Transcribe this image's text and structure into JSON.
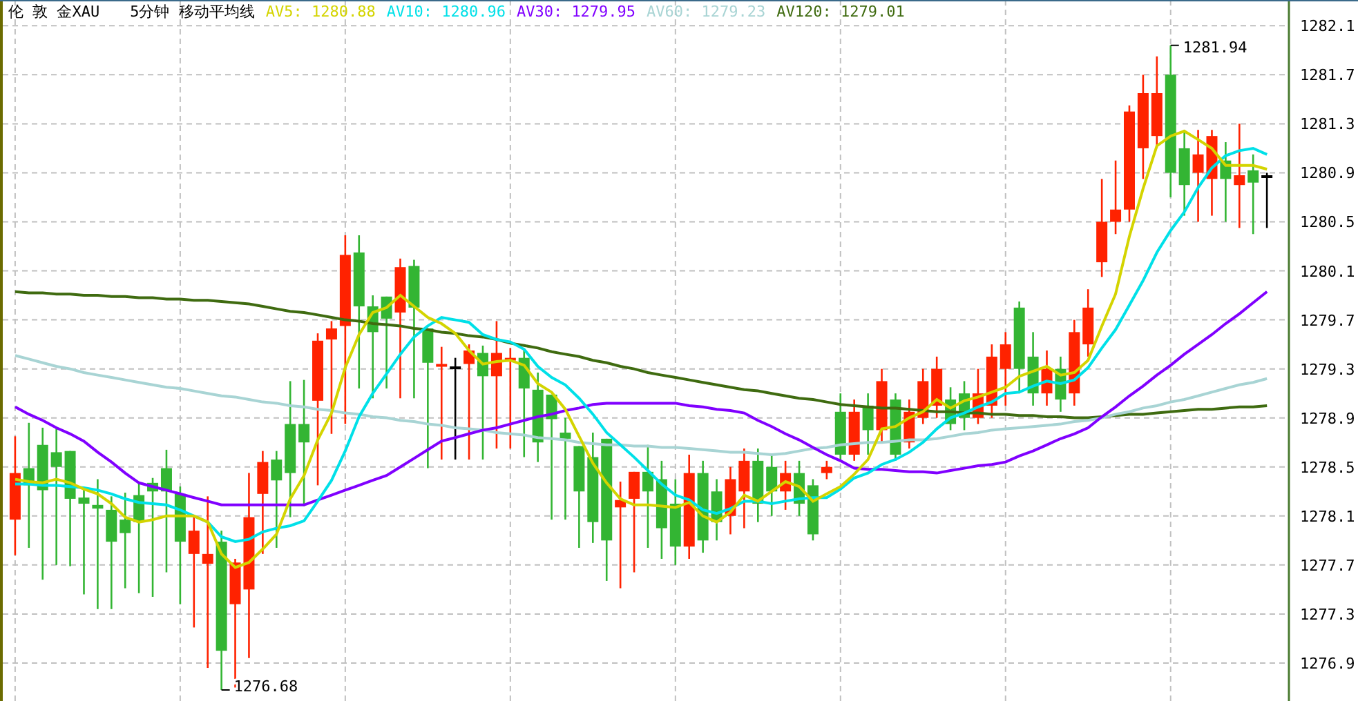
{
  "header": {
    "instrument": "伦 敦 金XAU",
    "period": "5分钟 移动平均线",
    "legend": [
      {
        "value": "1280.88"
      },
      {
        "value": "1280.96"
      },
      {
        "value": "1279.95"
      },
      {
        "value": "1279.23"
      },
      {
        "value": "1279.01"
      }
    ]
  },
  "chart": {
    "chart_data": {
      "type": "candlestick",
      "grid": true,
      "ohlc": [
        [
          1278.07,
          1278.75,
          1277.78,
          1278.45
        ],
        [
          1278.49,
          1278.86,
          1277.84,
          1278.35
        ],
        [
          1278.68,
          1278.82,
          1277.58,
          1278.31
        ],
        [
          1278.62,
          1278.82,
          1277.7,
          1278.5
        ],
        [
          1278.63,
          1278.63,
          1277.69,
          1278.24
        ],
        [
          1278.25,
          1278.32,
          1277.46,
          1278.2
        ],
        [
          1278.19,
          1278.4,
          1277.34,
          1278.16
        ],
        [
          1278.15,
          1278.26,
          1277.34,
          1277.89
        ],
        [
          1278.07,
          1278.29,
          1277.51,
          1277.96
        ],
        [
          1278.27,
          1278.37,
          1277.47,
          1278.05
        ],
        [
          1278.37,
          1278.41,
          1277.44,
          1278.3
        ],
        [
          1278.49,
          1278.64,
          1277.64,
          1278.3
        ],
        [
          1278.28,
          1278.34,
          1277.38,
          1277.89
        ],
        [
          1277.79,
          1278.11,
          1277.19,
          1277.98
        ],
        [
          1277.71,
          1278.26,
          1276.86,
          1277.79
        ],
        [
          1277.89,
          1277.98,
          1276.68,
          1277.0
        ],
        [
          1277.38,
          1277.75,
          1276.7,
          1277.72
        ],
        [
          1277.5,
          1278.45,
          1276.94,
          1278.09
        ],
        [
          1278.28,
          1278.63,
          1277.79,
          1278.54
        ],
        [
          1278.56,
          1278.63,
          1277.84,
          1278.39
        ],
        [
          1278.85,
          1279.2,
          1278.09,
          1278.45
        ],
        [
          1278.85,
          1279.21,
          1278.18,
          1278.7
        ],
        [
          1279.04,
          1279.59,
          1278.35,
          1279.53
        ],
        [
          1279.54,
          1279.69,
          1278.77,
          1279.63
        ],
        [
          1279.65,
          1280.39,
          1278.85,
          1280.23
        ],
        [
          1280.25,
          1280.39,
          1279.14,
          1279.81
        ],
        [
          1279.81,
          1279.9,
          1279.06,
          1279.6
        ],
        [
          1279.89,
          1279.89,
          1279.14,
          1279.71
        ],
        [
          1279.76,
          1280.2,
          1279.06,
          1280.13
        ],
        [
          1280.14,
          1280.19,
          1279.06,
          1279.8
        ],
        [
          1279.63,
          1279.63,
          1278.49,
          1279.35
        ],
        [
          1279.32,
          1279.48,
          1278.56,
          1279.34
        ],
        [
          1279.32,
          1279.39,
          1278.56,
          1279.32
        ],
        [
          1279.34,
          1279.5,
          1278.56,
          1279.45
        ],
        [
          1279.43,
          1279.49,
          1278.56,
          1279.24
        ],
        [
          1279.24,
          1279.69,
          1278.65,
          1279.43
        ],
        [
          1279.37,
          1279.47,
          1278.65,
          1279.39
        ],
        [
          1279.39,
          1279.46,
          1278.58,
          1279.14
        ],
        [
          1279.13,
          1279.27,
          1278.54,
          1278.7
        ],
        [
          1279.09,
          1279.09,
          1278.07,
          1278.89
        ],
        [
          1278.78,
          1278.9,
          1278.07,
          1278.73
        ],
        [
          1278.67,
          1278.67,
          1277.84,
          1278.3
        ],
        [
          1278.58,
          1278.78,
          1277.88,
          1278.05
        ],
        [
          1278.73,
          1278.73,
          1277.57,
          1277.9
        ],
        [
          1278.17,
          1278.38,
          1277.51,
          1278.23
        ],
        [
          1278.24,
          1278.46,
          1277.64,
          1278.46
        ],
        [
          1278.46,
          1278.68,
          1277.84,
          1278.3
        ],
        [
          1278.4,
          1278.55,
          1277.75,
          1278.0
        ],
        [
          1278.2,
          1278.4,
          1277.7,
          1277.85
        ],
        [
          1277.85,
          1278.6,
          1277.75,
          1278.45
        ],
        [
          1278.45,
          1278.55,
          1277.8,
          1277.9
        ],
        [
          1278.3,
          1278.4,
          1277.9,
          1278.05
        ],
        [
          1278.1,
          1278.5,
          1277.95,
          1278.4
        ],
        [
          1278.3,
          1278.65,
          1278.0,
          1278.55
        ],
        [
          1278.55,
          1278.65,
          1278.05,
          1278.2
        ],
        [
          1278.5,
          1278.6,
          1278.1,
          1278.3
        ],
        [
          1278.3,
          1278.55,
          1278.15,
          1278.45
        ],
        [
          1278.45,
          1278.55,
          1278.1,
          1278.2
        ],
        [
          1278.35,
          1278.4,
          1277.9,
          1277.95
        ],
        [
          1278.45,
          1278.55,
          1278.4,
          1278.5
        ],
        [
          1278.95,
          1279.1,
          1278.55,
          1278.6
        ],
        [
          1278.6,
          1279.05,
          1278.55,
          1278.95
        ],
        [
          1279.0,
          1279.1,
          1278.6,
          1278.8
        ],
        [
          1278.8,
          1279.3,
          1278.7,
          1279.2
        ],
        [
          1279.05,
          1279.1,
          1278.55,
          1278.6
        ],
        [
          1278.7,
          1279.05,
          1278.65,
          1278.95
        ],
        [
          1278.9,
          1279.3,
          1278.85,
          1279.2
        ],
        [
          1279.0,
          1279.4,
          1278.9,
          1279.3
        ],
        [
          1279.05,
          1279.15,
          1278.8,
          1278.85
        ],
        [
          1279.1,
          1279.2,
          1278.8,
          1278.9
        ],
        [
          1278.9,
          1279.3,
          1278.85,
          1279.1
        ],
        [
          1279.0,
          1279.5,
          1278.9,
          1279.4
        ],
        [
          1279.3,
          1279.6,
          1279.0,
          1279.5
        ],
        [
          1279.8,
          1279.85,
          1279.1,
          1279.3
        ],
        [
          1279.4,
          1279.6,
          1279.0,
          1279.1
        ],
        [
          1279.1,
          1279.45,
          1279.0,
          1279.3
        ],
        [
          1279.3,
          1279.4,
          1278.95,
          1279.05
        ],
        [
          1279.1,
          1279.7,
          1279.0,
          1279.6
        ],
        [
          1279.5,
          1279.95,
          1279.4,
          1279.8
        ],
        [
          1280.17,
          1280.85,
          1280.05,
          1280.5
        ],
        [
          1280.5,
          1281.0,
          1280.4,
          1280.6
        ],
        [
          1280.6,
          1281.45,
          1280.5,
          1281.4
        ],
        [
          1281.1,
          1281.7,
          1280.85,
          1281.55
        ],
        [
          1281.2,
          1281.85,
          1281.1,
          1281.55
        ],
        [
          1281.7,
          1281.94,
          1280.7,
          1280.9
        ],
        [
          1281.1,
          1281.25,
          1280.55,
          1280.8
        ],
        [
          1280.9,
          1281.25,
          1280.5,
          1281.05
        ],
        [
          1280.85,
          1281.25,
          1280.55,
          1281.2
        ],
        [
          1281.0,
          1281.15,
          1280.5,
          1280.85
        ],
        [
          1280.8,
          1281.3,
          1280.45,
          1280.88
        ],
        [
          1280.92,
          1281.05,
          1280.4,
          1280.82
        ],
        [
          1280.88,
          1280.9,
          1280.45,
          1280.88
        ]
      ],
      "ylim": [
        1276.59,
        1282.31
      ],
      "yticks": [
        {
          "value": 1282.1,
          "label": "1282.1"
        },
        {
          "value": 1281.7,
          "label": "1281.7"
        },
        {
          "value": 1281.3,
          "label": "1281.3"
        },
        {
          "value": 1280.9,
          "label": "1280.9"
        },
        {
          "value": 1280.5,
          "label": "1280.5"
        },
        {
          "value": 1280.1,
          "label": "1280.1"
        },
        {
          "value": 1279.7,
          "label": "1279.7"
        },
        {
          "value": 1279.3,
          "label": "1279.3"
        },
        {
          "value": 1278.9,
          "label": "1278.9"
        },
        {
          "value": 1278.5,
          "label": "1278.5"
        },
        {
          "value": 1278.1,
          "label": "1278.1"
        },
        {
          "value": 1277.7,
          "label": "1277.7"
        },
        {
          "value": 1277.3,
          "label": "1277.3"
        },
        {
          "value": 1276.9,
          "label": "1276.9"
        }
      ],
      "series": [
        {
          "name": "AV5:",
          "type": "line",
          "color": "#d4d400",
          "values": [
            1278.4,
            1278.38,
            1278.37,
            1278.4,
            1278.37,
            1278.32,
            1278.28,
            1278.2,
            1278.09,
            1278.05,
            1278.07,
            1278.1,
            1278.1,
            1278.1,
            1278.05,
            1277.79,
            1277.68,
            1277.72,
            1277.83,
            1277.95,
            1278.24,
            1278.43,
            1278.72,
            1278.94,
            1279.31,
            1279.58,
            1279.76,
            1279.8,
            1279.9,
            1279.81,
            1279.72,
            1279.67,
            1279.59,
            1279.45,
            1279.34,
            1279.36,
            1279.37,
            1279.33,
            1279.18,
            1279.11,
            1278.97,
            1278.75,
            1278.53,
            1278.37,
            1278.24,
            1278.19,
            1278.19,
            1278.18,
            1278.17,
            1278.21,
            1278.1,
            1278.05,
            1278.13,
            1278.27,
            1278.22,
            1278.3,
            1278.38,
            1278.34,
            1278.22,
            1278.28,
            1278.34,
            1278.44,
            1278.56,
            1278.81,
            1278.83,
            1278.9,
            1278.95,
            1279.05,
            1278.98,
            1279.04,
            1279.07,
            1279.11,
            1279.15,
            1279.24,
            1279.28,
            1279.32,
            1279.25,
            1279.27,
            1279.37,
            1279.65,
            1279.91,
            1280.38,
            1280.77,
            1281.12,
            1281.2,
            1281.24,
            1281.17,
            1281.1,
            1280.96,
            1280.96,
            1280.96,
            1280.93
          ]
        },
        {
          "name": "AV10:",
          "type": "line",
          "color": "#00e0e8",
          "values": [
            1278.36,
            1278.36,
            1278.35,
            1278.35,
            1278.34,
            1278.33,
            1278.31,
            1278.28,
            1278.24,
            1278.21,
            1278.2,
            1278.19,
            1278.15,
            1278.1,
            1278.05,
            1277.93,
            1277.89,
            1277.91,
            1277.97,
            1278.0,
            1278.02,
            1278.06,
            1278.22,
            1278.39,
            1278.63,
            1278.91,
            1279.1,
            1279.26,
            1279.42,
            1279.56,
            1279.65,
            1279.72,
            1279.7,
            1279.68,
            1279.58,
            1279.54,
            1279.52,
            1279.46,
            1279.32,
            1279.23,
            1279.17,
            1279.06,
            1278.93,
            1278.78,
            1278.68,
            1278.58,
            1278.47,
            1278.36,
            1278.27,
            1278.23,
            1278.15,
            1278.12,
            1278.16,
            1278.22,
            1278.22,
            1278.2,
            1278.22,
            1278.24,
            1278.25,
            1278.25,
            1278.32,
            1278.41,
            1278.45,
            1278.52,
            1278.56,
            1278.62,
            1278.7,
            1278.81,
            1278.9,
            1278.94,
            1278.99,
            1279.03,
            1279.1,
            1279.11,
            1279.16,
            1279.2,
            1279.18,
            1279.21,
            1279.31,
            1279.47,
            1279.62,
            1279.82,
            1280.02,
            1280.25,
            1280.43,
            1280.58,
            1280.78,
            1280.94,
            1281.04,
            1281.08,
            1281.1,
            1281.05
          ]
        },
        {
          "name": "AV30:",
          "type": "line",
          "color": "#8000ff",
          "values": [
            1278.99,
            1278.93,
            1278.88,
            1278.82,
            1278.77,
            1278.71,
            1278.62,
            1278.54,
            1278.45,
            1278.37,
            1278.34,
            1278.31,
            1278.28,
            1278.25,
            1278.22,
            1278.19,
            1278.19,
            1278.19,
            1278.19,
            1278.19,
            1278.19,
            1278.19,
            1278.23,
            1278.27,
            1278.31,
            1278.35,
            1278.39,
            1278.43,
            1278.5,
            1278.57,
            1278.64,
            1278.71,
            1278.74,
            1278.77,
            1278.8,
            1278.82,
            1278.85,
            1278.88,
            1278.91,
            1278.93,
            1278.96,
            1278.98,
            1279.01,
            1279.02,
            1279.02,
            1279.02,
            1279.02,
            1279.02,
            1279.02,
            1279.0,
            1278.99,
            1278.97,
            1278.96,
            1278.94,
            1278.88,
            1278.83,
            1278.77,
            1278.72,
            1278.66,
            1278.6,
            1278.55,
            1278.49,
            1278.48,
            1278.48,
            1278.47,
            1278.46,
            1278.46,
            1278.45,
            1278.47,
            1278.49,
            1278.51,
            1278.52,
            1278.54,
            1278.59,
            1278.63,
            1278.68,
            1278.73,
            1278.77,
            1278.82,
            1278.91,
            1278.99,
            1279.08,
            1279.16,
            1279.25,
            1279.33,
            1279.42,
            1279.5,
            1279.58,
            1279.67,
            1279.75,
            1279.84,
            1279.93
          ]
        },
        {
          "name": "AV60:",
          "type": "line",
          "color": "#a8d4d4",
          "values": [
            1279.41,
            1279.38,
            1279.35,
            1279.32,
            1279.3,
            1279.27,
            1279.25,
            1279.23,
            1279.21,
            1279.19,
            1279.17,
            1279.15,
            1279.14,
            1279.12,
            1279.1,
            1279.08,
            1279.07,
            1279.05,
            1279.03,
            1279.02,
            1279.0,
            1278.99,
            1278.97,
            1278.96,
            1278.94,
            1278.93,
            1278.91,
            1278.9,
            1278.88,
            1278.87,
            1278.85,
            1278.84,
            1278.82,
            1278.81,
            1278.8,
            1278.78,
            1278.77,
            1278.76,
            1278.74,
            1278.73,
            1278.72,
            1278.7,
            1278.69,
            1278.68,
            1278.68,
            1278.67,
            1278.67,
            1278.66,
            1278.66,
            1278.65,
            1278.64,
            1278.63,
            1278.62,
            1278.62,
            1278.61,
            1278.6,
            1278.61,
            1278.63,
            1278.65,
            1278.66,
            1278.68,
            1278.69,
            1278.7,
            1278.7,
            1278.71,
            1278.72,
            1278.72,
            1278.73,
            1278.75,
            1278.77,
            1278.78,
            1278.8,
            1278.81,
            1278.82,
            1278.83,
            1278.84,
            1278.85,
            1278.87,
            1278.88,
            1278.9,
            1278.93,
            1278.95,
            1278.98,
            1279.0,
            1279.03,
            1279.05,
            1279.08,
            1279.11,
            1279.14,
            1279.17,
            1279.19,
            1279.22
          ]
        },
        {
          "name": "AV120:",
          "type": "line",
          "color": "#3f6b10",
          "values": [
            1279.93,
            1279.92,
            1279.92,
            1279.91,
            1279.91,
            1279.9,
            1279.9,
            1279.89,
            1279.89,
            1279.88,
            1279.88,
            1279.87,
            1279.87,
            1279.86,
            1279.86,
            1279.85,
            1279.84,
            1279.83,
            1279.81,
            1279.79,
            1279.77,
            1279.76,
            1279.74,
            1279.72,
            1279.7,
            1279.69,
            1279.67,
            1279.66,
            1279.65,
            1279.63,
            1279.62,
            1279.6,
            1279.59,
            1279.57,
            1279.56,
            1279.54,
            1279.51,
            1279.49,
            1279.47,
            1279.44,
            1279.42,
            1279.4,
            1279.37,
            1279.35,
            1279.32,
            1279.3,
            1279.27,
            1279.25,
            1279.23,
            1279.21,
            1279.19,
            1279.17,
            1279.15,
            1279.13,
            1279.12,
            1279.1,
            1279.08,
            1279.06,
            1279.05,
            1279.03,
            1279.01,
            1279.0,
            1278.99,
            1278.98,
            1278.98,
            1278.97,
            1278.96,
            1278.95,
            1278.95,
            1278.94,
            1278.94,
            1278.93,
            1278.93,
            1278.92,
            1278.92,
            1278.91,
            1278.91,
            1278.9,
            1278.9,
            1278.91,
            1278.92,
            1278.93,
            1278.93,
            1278.94,
            1278.95,
            1278.96,
            1278.97,
            1278.97,
            1278.98,
            1278.99,
            1278.99,
            1279.0
          ]
        }
      ],
      "annotations": [
        "1281.94",
        "1276.68"
      ]
    }
  }
}
